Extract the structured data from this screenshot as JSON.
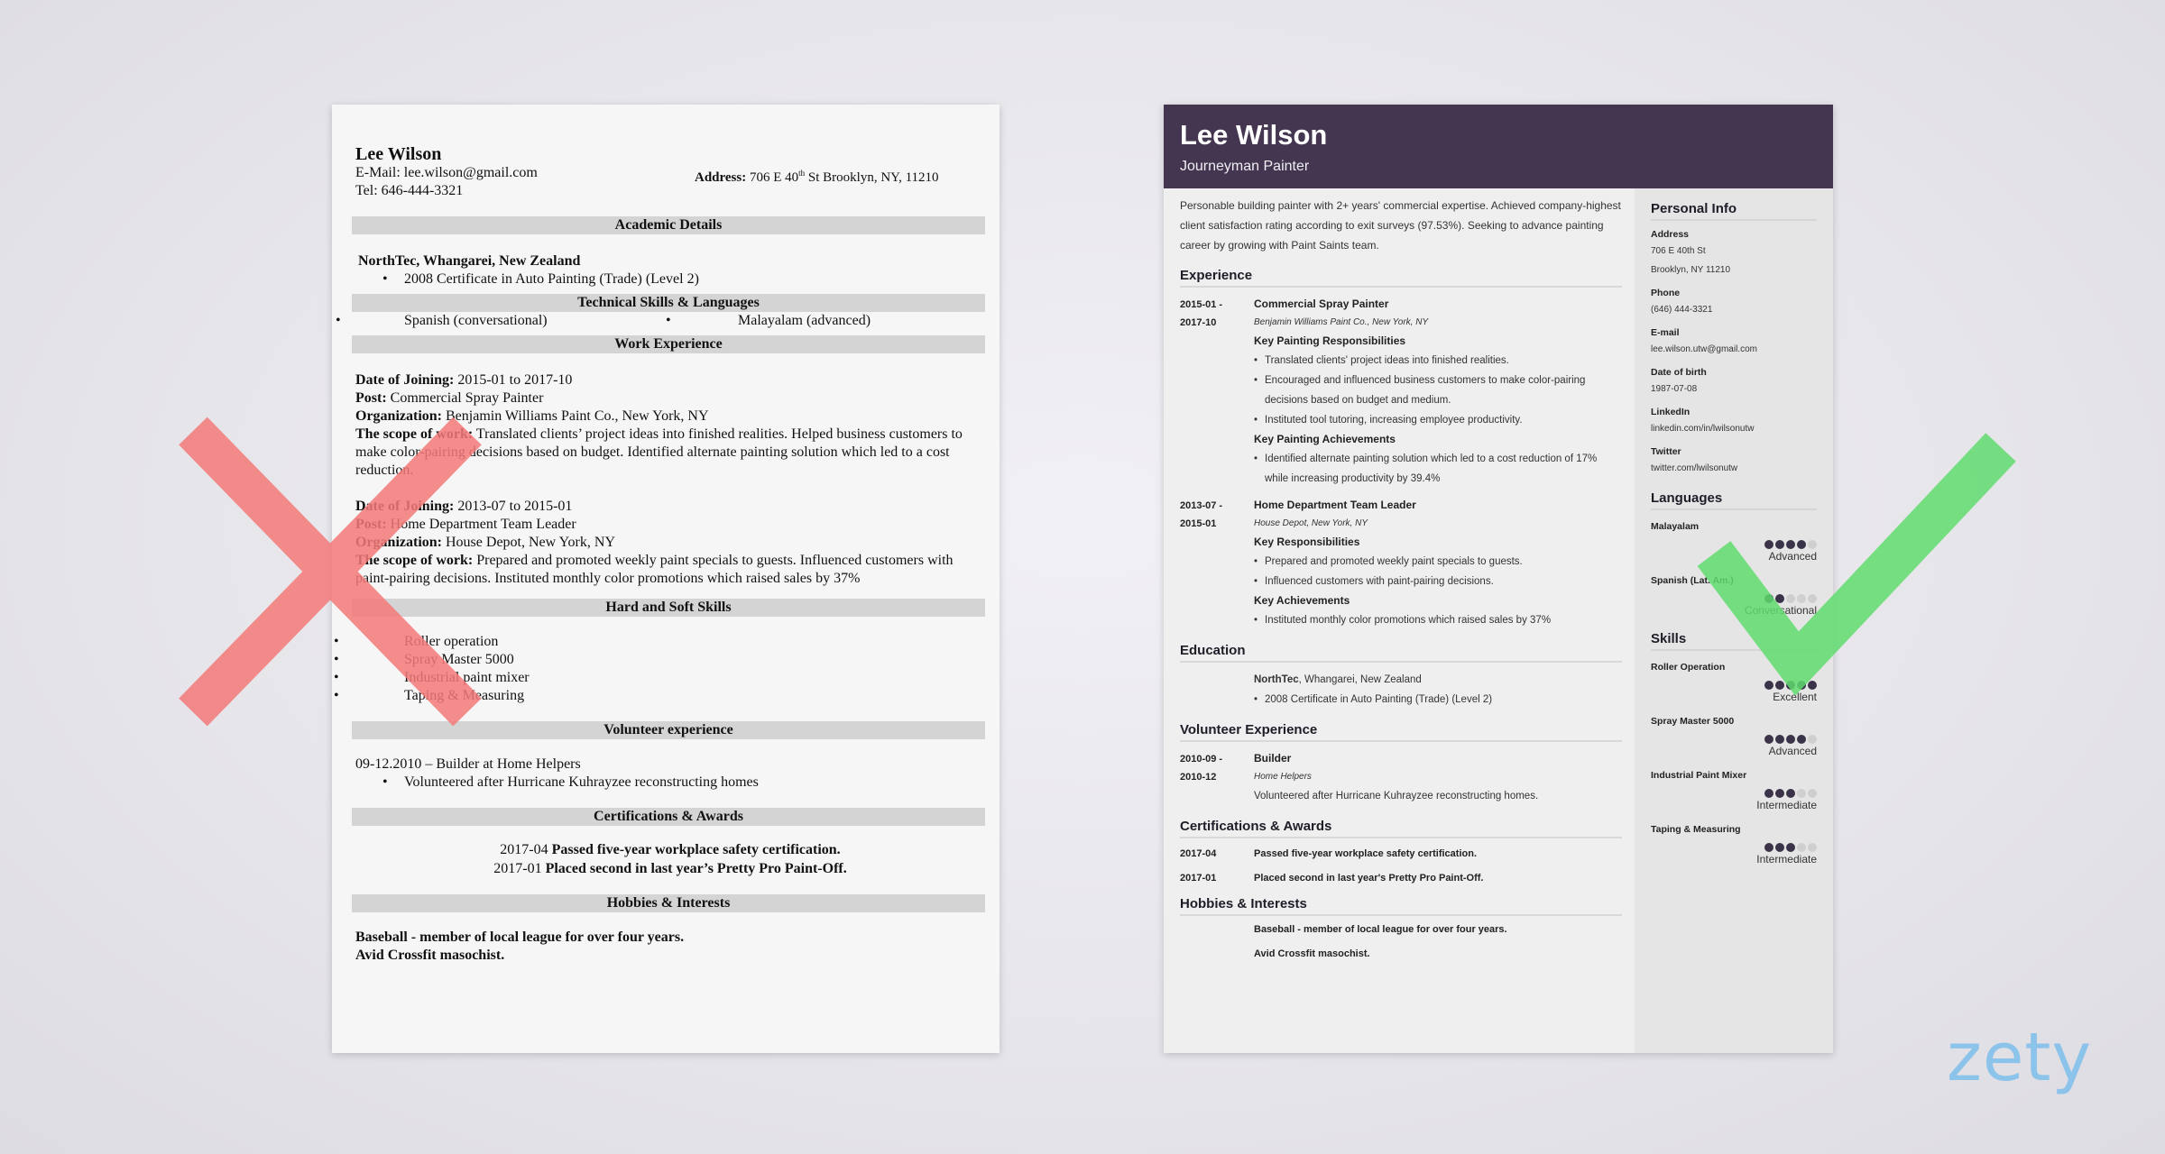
{
  "bad_resume": {
    "name": "Lee Wilson",
    "email_label": "E-Mail:",
    "email": "lee.wilson@gmail.com",
    "address_label": "Address:",
    "address_pre": "706 E 40",
    "address_sup": "th",
    "address_post": " St Brooklyn, NY, 11210",
    "tel": "Tel: 646-444-3321",
    "sections": {
      "academic": "Academic Details",
      "technical": "Technical Skills & Languages",
      "work": "Work Experience",
      "skills": "Hard and Soft Skills",
      "volunteer": "Volunteer experience",
      "certs": "Certifications & Awards",
      "hobbies": "Hobbies & Interests"
    },
    "academic": {
      "school": "NorthTec, Whangarei, New Zealand",
      "item": "2008 Certificate in Auto Painting (Trade) (Level 2)"
    },
    "languages": [
      "Spanish (conversational)",
      "Malayalam (advanced)"
    ],
    "work_labels": {
      "date": "Date of Joining:",
      "post": "Post:",
      "org": "Organization:",
      "scope": "The scope of work:"
    },
    "work": [
      {
        "date": " 2015-01 to 2017-10",
        "post": " Commercial Spray Painter",
        "org": " Benjamin Williams Paint Co., New York, NY",
        "scope": " Translated clients’ project ideas into finished realities. Helped business customers to make color-pairing decisions based on budget. Identified alternate painting solution which led to a cost reduction."
      },
      {
        "date": " 2013-07 to 2015-01",
        "post": " Home Department Team Leader",
        "org": " House Depot, New York, NY",
        "scope": " Prepared and promoted weekly paint specials to guests. Influenced customers with paint-pairing decisions. Instituted monthly color promotions which raised sales by 37%"
      }
    ],
    "skills": [
      "Roller operation",
      "Spray Master 5000",
      "Industrial paint mixer",
      "Taping & Measuring"
    ],
    "volunteer": {
      "line": "09-12.2010 – Builder at Home Helpers",
      "item": "Volunteered after Hurricane Kuhrayzee reconstructing homes"
    },
    "certs": [
      {
        "date": "2017-04 ",
        "text": "Passed five-year workplace safety certification."
      },
      {
        "date": "2017-01 ",
        "text": "Placed second in last year’s Pretty Pro Paint-Off."
      }
    ],
    "hobbies": [
      "Baseball - member of local league for over four years.",
      "Avid Crossfit masochist."
    ]
  },
  "good_resume": {
    "name": "Lee Wilson",
    "title": "Journeyman Painter",
    "accent_color": "#443650",
    "summary": "Personable building painter with 2+ years' commercial expertise. Achieved company-highest client satisfaction rating according to exit surveys (97.53%). Seeking to advance painting career by growing with Paint Saints team.",
    "sections": {
      "experience": "Experience",
      "education": "Education",
      "volunteer": "Volunteer Experience",
      "certs": "Certifications & Awards",
      "hobbies": "Hobbies & Interests",
      "personal": "Personal Info",
      "languages": "Languages",
      "skills": "Skills"
    },
    "experience": [
      {
        "date_start": "2015-01 -",
        "date_end": "2017-10",
        "title": "Commercial Spray Painter",
        "company": "Benjamin Williams Paint Co., New York, NY",
        "resp_heading": "Key Painting Responsibilities",
        "resp": [
          "Translated clients' project ideas into finished realities.",
          "Encouraged and influenced business customers to make color-pairing decisions based on budget and medium.",
          "Instituted tool tutoring, increasing employee productivity."
        ],
        "ach_heading": "Key Painting Achievements",
        "ach": [
          "Identified alternate painting solution which led to a cost reduction of 17% while increasing productivity by 39.4%"
        ]
      },
      {
        "date_start": "2013-07 -",
        "date_end": "2015-01",
        "title": "Home Department Team Leader",
        "company": "House Depot, New York, NY",
        "resp_heading": "Key Responsibilities",
        "resp": [
          "Prepared and promoted weekly paint specials to guests.",
          "Influenced customers with paint-pairing decisions."
        ],
        "ach_heading": "Key Achievements",
        "ach": [
          "Instituted monthly color promotions which raised sales by 37%"
        ]
      }
    ],
    "education": {
      "school": "NorthTec",
      "location": ", Whangarei, New Zealand",
      "item": "2008 Certificate in Auto Painting (Trade) (Level 2)"
    },
    "volunteer": {
      "date_start": "2010-09 -",
      "date_end": "2010-12",
      "title": "Builder",
      "org": "Home Helpers",
      "desc": "Volunteered after Hurricane Kuhrayzee reconstructing homes."
    },
    "certs": [
      {
        "date": "2017-04",
        "text": "Passed five-year workplace safety certification."
      },
      {
        "date": "2017-01",
        "text": "Placed second in last year's Pretty Pro Paint-Off."
      }
    ],
    "hobbies": [
      "Baseball - member of local league for over four years.",
      "Avid Crossfit masochist."
    ],
    "personal": [
      {
        "label": "Address",
        "lines": [
          "706 E 40th St",
          "Brooklyn, NY 11210"
        ]
      },
      {
        "label": "Phone",
        "lines": [
          "(646) 444-3321"
        ]
      },
      {
        "label": "E-mail",
        "lines": [
          "lee.wilson.utw@gmail.com"
        ]
      },
      {
        "label": "Date of birth",
        "lines": [
          "1987-07-08"
        ]
      },
      {
        "label": "LinkedIn",
        "lines": [
          "linkedin.com/in/lwilsonutw"
        ]
      },
      {
        "label": "Twitter",
        "lines": [
          "twitter.com/lwilsonutw"
        ]
      }
    ],
    "languages": [
      {
        "name": "Malayalam",
        "rating": 4,
        "max": 5,
        "level": "Advanced"
      },
      {
        "name": "Spanish (Lat. Am.)",
        "rating": 2,
        "max": 5,
        "level": "Conversational"
      }
    ],
    "skills": [
      {
        "name": "Roller Operation",
        "rating": 5,
        "max": 5,
        "level": "Excellent"
      },
      {
        "name": "Spray Master 5000",
        "rating": 4,
        "max": 5,
        "level": "Advanced"
      },
      {
        "name": "Industrial Paint Mixer",
        "rating": 3,
        "max": 5,
        "level": "Intermediate"
      },
      {
        "name": "Taping & Measuring",
        "rating": 3,
        "max": 5,
        "level": "Intermediate"
      }
    ]
  },
  "marks": {
    "bad_icon": "x-mark-icon",
    "bad_color": "#f47a7a",
    "good_icon": "check-mark-icon",
    "good_color": "#5fdc6e"
  },
  "logo": {
    "text": "zety",
    "color": "#8cc3ea"
  }
}
